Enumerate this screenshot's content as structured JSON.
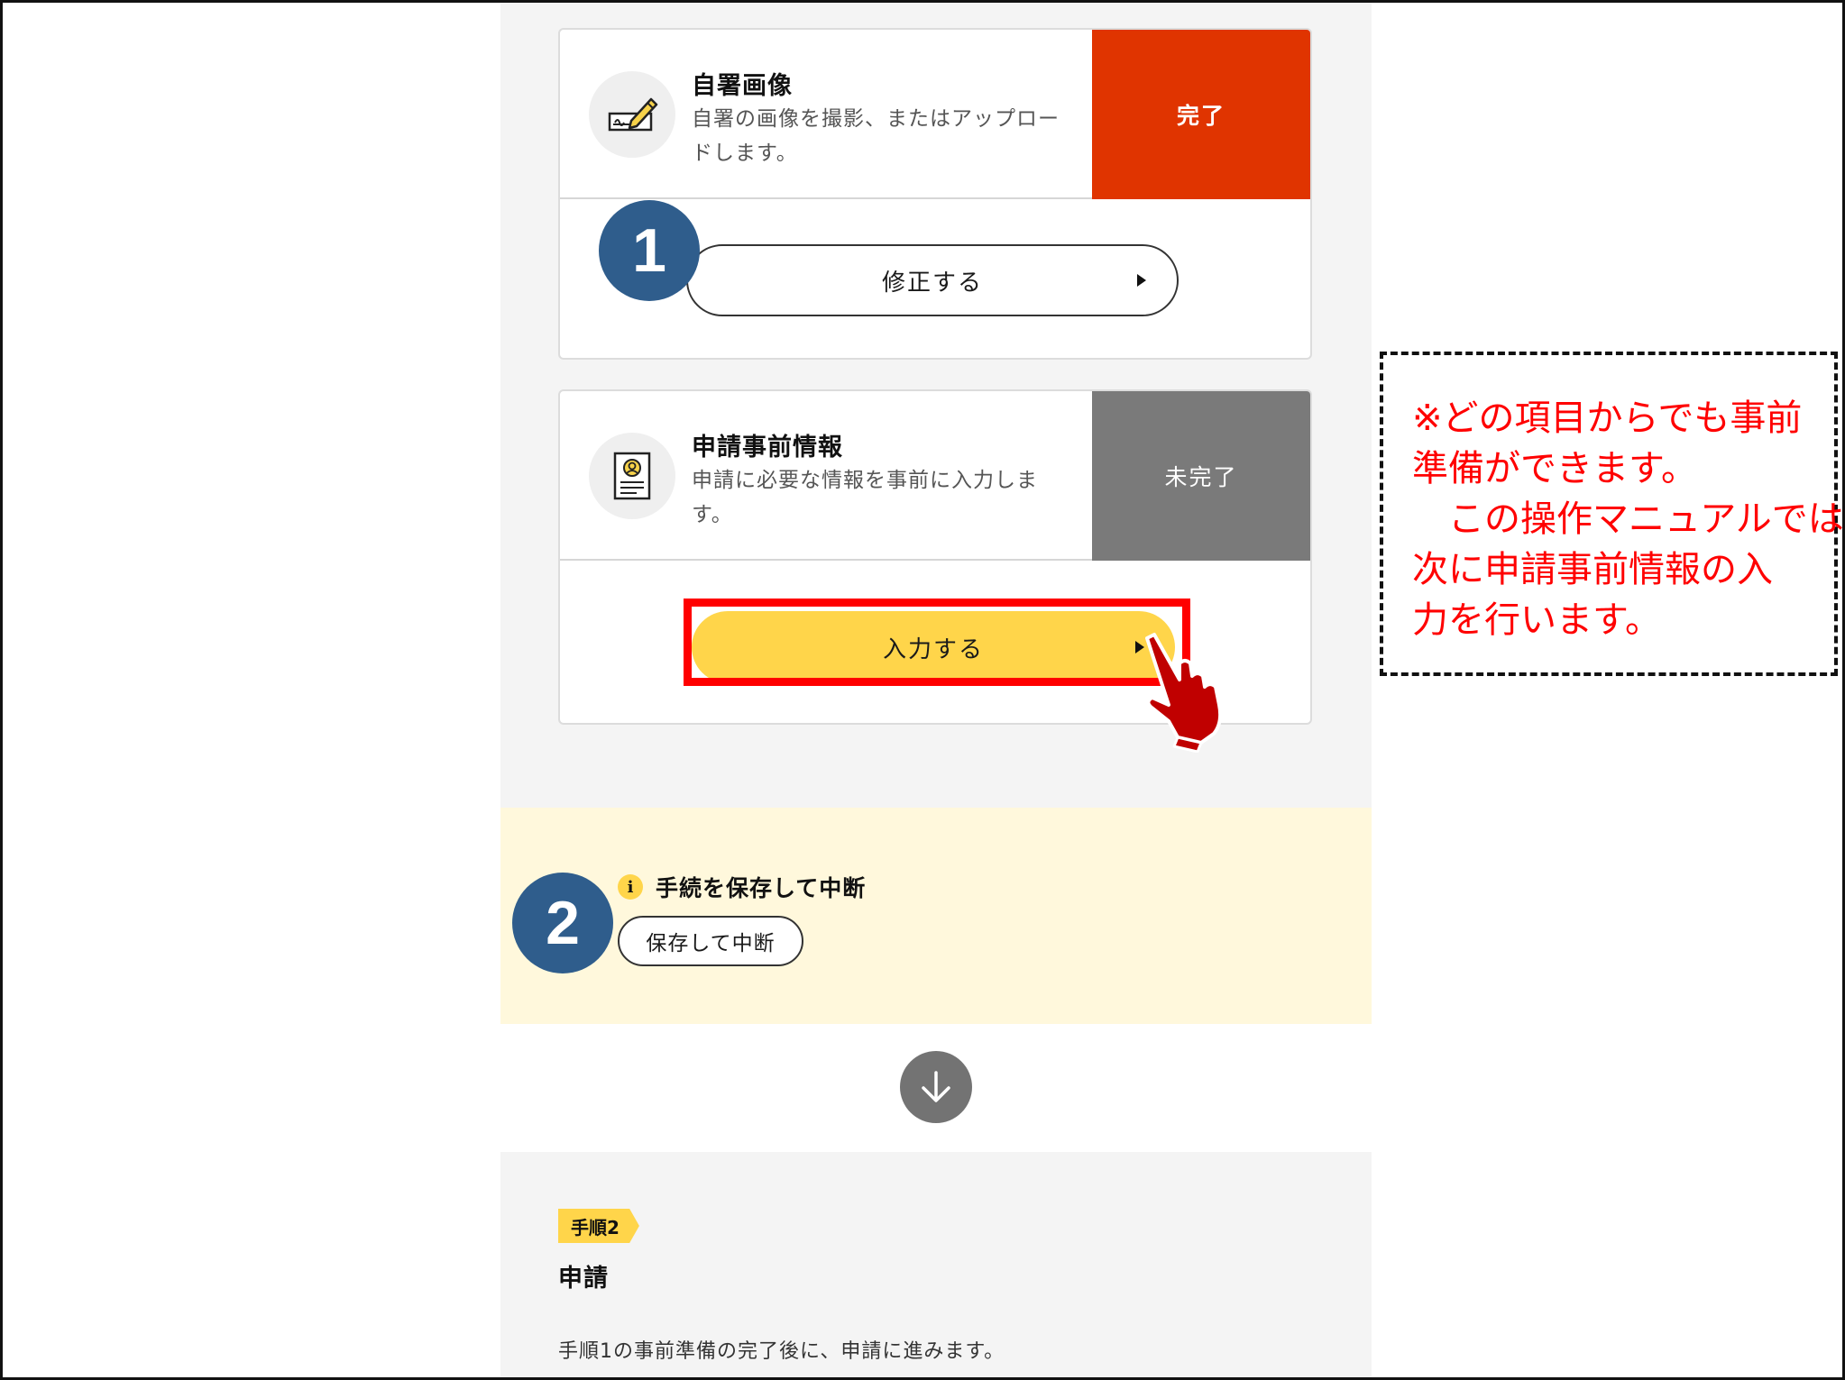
{
  "card1": {
    "title": "自署画像",
    "desc": "自署の画像を撮影、またはアップロードします。",
    "status": "完了",
    "button": "修正する",
    "icon": "signature-icon"
  },
  "card2": {
    "title": "申請事前情報",
    "desc": "申請に必要な情報を事前に入力します。",
    "status": "未完了",
    "button": "入力する",
    "icon": "document-profile-icon"
  },
  "badges": {
    "one": "1",
    "two": "2"
  },
  "notice": {
    "icon": "i",
    "title": "手続を保存して中断",
    "button": "保存して中断"
  },
  "step2": {
    "tag": "手順2",
    "title": "申請",
    "desc": "手順1の事前準備の完了後に、申請に進みます。"
  },
  "callout": {
    "lines": [
      "※どの項目からでも事前",
      "準備ができます。",
      "　この操作マニュアルでは",
      "次に申請事前情報の入",
      "力を行います。"
    ]
  },
  "colors": {
    "done": "#e03400",
    "todo": "#7a7a7a",
    "accent_yellow": "#ffd54a",
    "badge_blue": "#2f5d8c",
    "annotation_red": "#ff0000"
  }
}
